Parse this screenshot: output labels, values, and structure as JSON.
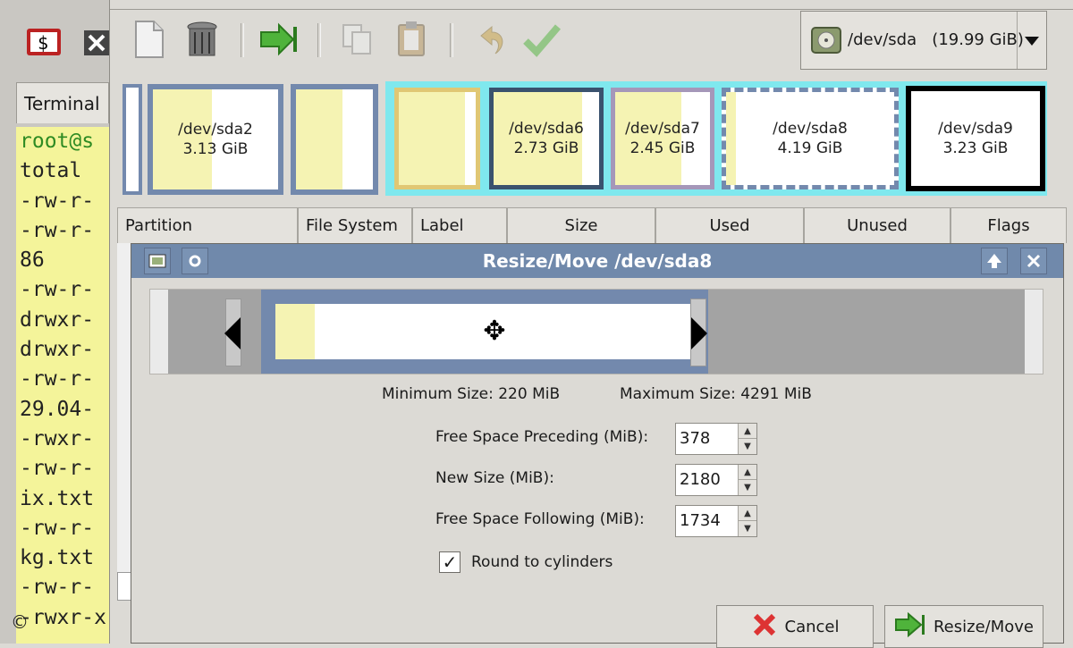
{
  "left_taskbar": {
    "terminal_tab_label": "Terminal"
  },
  "terminal": {
    "lines": [
      "root@s",
      "total",
      "-rw-r-",
      "-rw-r-",
      "86",
      "-rw-r-",
      "drwxr-",
      "drwxr-",
      "-rw-r-",
      "29.04-",
      "-rwxr-",
      "-rw-r-",
      "ix.txt",
      "-rw-r-",
      "kg.txt",
      "-rw-r-",
      "-rwxr-x"
    ]
  },
  "copyright_symbol": "©",
  "toolbar": {
    "icons": [
      "new-icon",
      "delete-icon",
      "resize-move-icon",
      "copy-icon",
      "paste-icon",
      "undo-icon",
      "apply-icon"
    ]
  },
  "device_selector": {
    "device": "/dev/sda",
    "size": "(19.99 GiB)"
  },
  "partition_map": {
    "partitions": [
      {
        "name": "",
        "size": "",
        "used_fraction": 0.0
      },
      {
        "name": "/dev/sda2",
        "size": "3.13 GiB",
        "used_fraction": 0.47
      },
      {
        "name": "",
        "size": "",
        "used_fraction": 0.6
      },
      {
        "name": "",
        "size": "",
        "used_fraction": 0.86
      },
      {
        "name": "/dev/sda6",
        "size": "2.73 GiB",
        "used_fraction": 0.84
      },
      {
        "name": "/dev/sda7",
        "size": "2.45 GiB",
        "used_fraction": 0.7
      },
      {
        "name": "/dev/sda8",
        "size": "4.19 GiB",
        "used_fraction": 0.06
      },
      {
        "name": "/dev/sda9",
        "size": "3.23 GiB",
        "used_fraction": 0.0
      }
    ]
  },
  "columns": [
    "Partition",
    "File System",
    "Label",
    "Size",
    "Used",
    "Unused",
    "Flags"
  ],
  "dialog": {
    "title": "Resize/Move /dev/sda8",
    "min_size_text": "Minimum Size: 220 MiB",
    "max_size_text": "Maximum Size: 4291 MiB",
    "free_preceding_label": "Free Space Preceding (MiB):",
    "free_preceding_value": "378",
    "new_size_label": "New Size (MiB):",
    "new_size_value": "2180",
    "free_following_label": "Free Space Following (MiB):",
    "free_following_value": "1734",
    "round_label": "Round to cylinders",
    "round_checked": true,
    "cancel_label": "Cancel",
    "resize_label": "Resize/Move"
  },
  "colors": {
    "titlebar": "#7089ab",
    "partition_border": "#7389ad",
    "used_fill": "#f5f3b3",
    "extended_border": "#7fe8ee",
    "terminal_bg": "#f4f49a"
  }
}
